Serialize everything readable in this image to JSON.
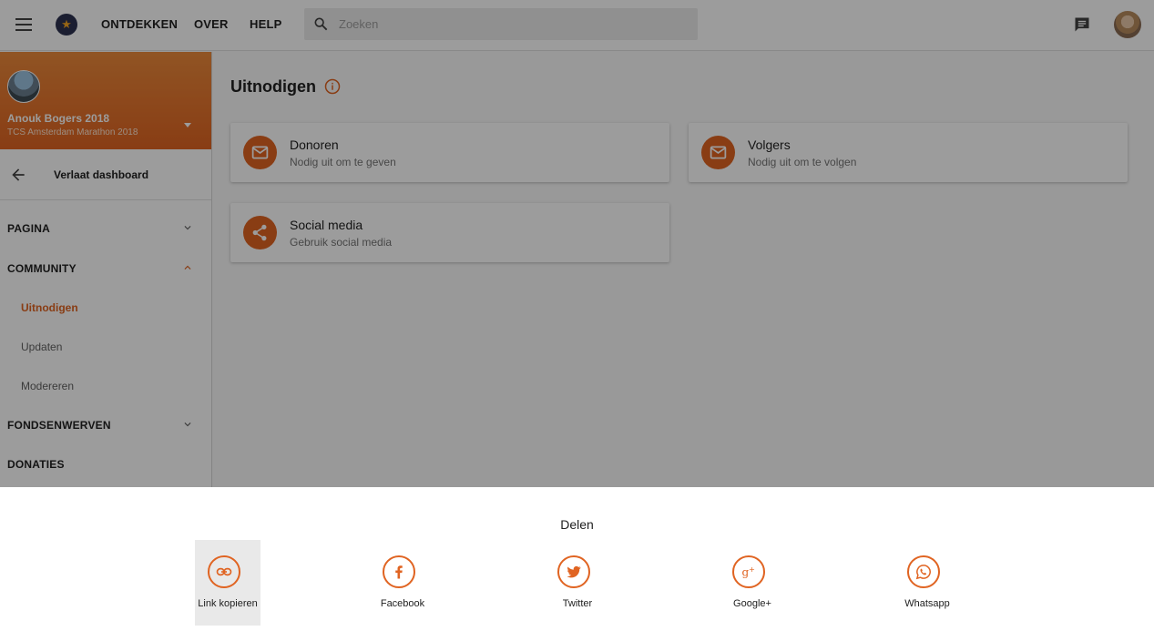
{
  "topbar": {
    "nav": [
      "ONTDEKKEN",
      "OVER",
      "HELP"
    ],
    "search_placeholder": "Zoeken"
  },
  "sidebar": {
    "profile_name": "Anouk Bogers 2018",
    "profile_event": "TCS Amsterdam Marathon 2018",
    "leave_label": "Verlaat dashboard",
    "sections": {
      "pagina": "PAGINA",
      "community": "COMMUNITY",
      "fondsenwerven": "FONDSENWERVEN",
      "donaties": "DONATIES"
    },
    "community_items": [
      "Uitnodigen",
      "Updaten",
      "Modereren"
    ]
  },
  "main": {
    "title": "Uitnodigen",
    "cards": [
      {
        "title": "Donoren",
        "subtitle": "Nodig uit om te geven",
        "icon": "mail-icon"
      },
      {
        "title": "Volgers",
        "subtitle": "Nodig uit om te volgen",
        "icon": "mail-icon"
      },
      {
        "title": "Social media",
        "subtitle": "Gebruik social media",
        "icon": "share-icon"
      }
    ]
  },
  "share_sheet": {
    "title": "Delen",
    "options": [
      {
        "label": "Link kopieren",
        "icon": "link-icon"
      },
      {
        "label": "Facebook",
        "icon": "facebook-icon"
      },
      {
        "label": "Twitter",
        "icon": "twitter-icon"
      },
      {
        "label": "Google+",
        "icon": "google-plus-icon"
      },
      {
        "label": "Whatsapp",
        "icon": "whatsapp-icon"
      }
    ]
  },
  "colors": {
    "accent": "#e06422",
    "overlay": "rgba(0,0,0,0.39)"
  }
}
